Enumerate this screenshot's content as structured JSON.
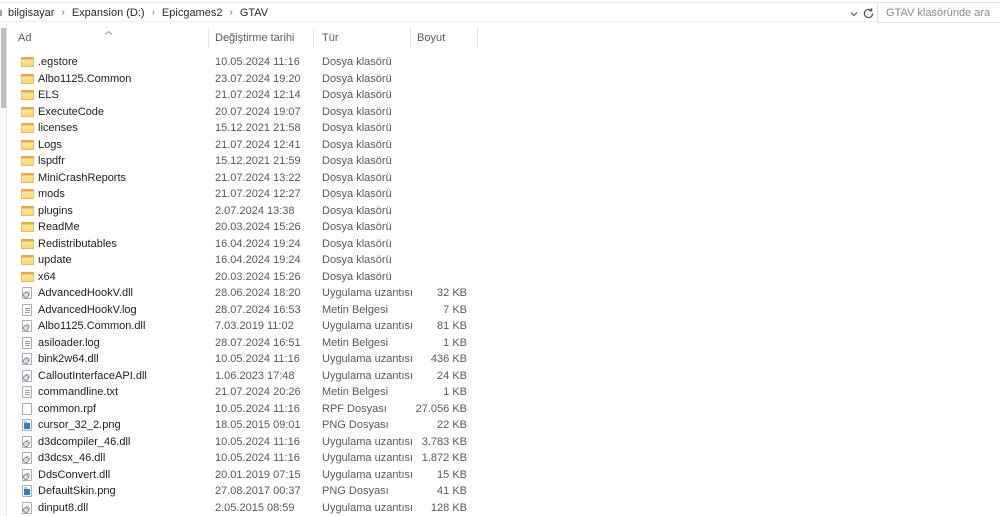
{
  "topbar": {
    "breadcrumb": {
      "crumbs": [
        "bilgisayar",
        "Expansion (D:)",
        "Epicgames2",
        "GTAV"
      ],
      "separator": "›"
    },
    "search": {
      "placeholder": "GTAV klasöründe ara"
    }
  },
  "table": {
    "columns": [
      {
        "label": "Ad"
      },
      {
        "label": "Değiştirme tarihi"
      },
      {
        "label": "Tür"
      },
      {
        "label": "Boyut"
      }
    ],
    "sort": {
      "column": "Ad",
      "direction": "ascending"
    },
    "rows": [
      {
        "name": ".egstore",
        "date": "10.05.2024 11:16",
        "type": "Dosya klasörü",
        "size": "",
        "icon": "folder"
      },
      {
        "name": "Albo1125.Common",
        "date": "23.07.2024 19:20",
        "type": "Dosya klasörü",
        "size": "",
        "icon": "folder"
      },
      {
        "name": "ELS",
        "date": "21.07.2024 12:14",
        "type": "Dosya klasörü",
        "size": "",
        "icon": "folder"
      },
      {
        "name": "ExecuteCode",
        "date": "20.07.2024 19:07",
        "type": "Dosya klasörü",
        "size": "",
        "icon": "folder"
      },
      {
        "name": "licenses",
        "date": "15.12.2021 21:58",
        "type": "Dosya klasörü",
        "size": "",
        "icon": "folder"
      },
      {
        "name": "Logs",
        "date": "21.07.2024 12:41",
        "type": "Dosya klasörü",
        "size": "",
        "icon": "folder"
      },
      {
        "name": "lspdfr",
        "date": "15.12.2021 21:59",
        "type": "Dosya klasörü",
        "size": "",
        "icon": "folder"
      },
      {
        "name": "MiniCrashReports",
        "date": "21.07.2024 13:22",
        "type": "Dosya klasörü",
        "size": "",
        "icon": "folder"
      },
      {
        "name": "mods",
        "date": "21.07.2024 12:27",
        "type": "Dosya klasörü",
        "size": "",
        "icon": "folder"
      },
      {
        "name": "plugins",
        "date": "2.07.2024 13:38",
        "type": "Dosya klasörü",
        "size": "",
        "icon": "folder"
      },
      {
        "name": "ReadMe",
        "date": "20.03.2024 15:26",
        "type": "Dosya klasörü",
        "size": "",
        "icon": "folder"
      },
      {
        "name": "Redistributables",
        "date": "16.04.2024 19:24",
        "type": "Dosya klasörü",
        "size": "",
        "icon": "folder"
      },
      {
        "name": "update",
        "date": "16.04.2024 19:24",
        "type": "Dosya klasörü",
        "size": "",
        "icon": "folder"
      },
      {
        "name": "x64",
        "date": "20.03.2024 15:26",
        "type": "Dosya klasörü",
        "size": "",
        "icon": "folder"
      },
      {
        "name": "AdvancedHookV.dll",
        "date": "28.06.2024 18:20",
        "type": "Uygulama uzantısı",
        "size": "32 KB",
        "icon": "dll"
      },
      {
        "name": "AdvancedHookV.log",
        "date": "28.07.2024 16:53",
        "type": "Metin Belgesi",
        "size": "7 KB",
        "icon": "text"
      },
      {
        "name": "Albo1125.Common.dll",
        "date": "7.03.2019 11:02",
        "type": "Uygulama uzantısı",
        "size": "81 KB",
        "icon": "dll"
      },
      {
        "name": "asiloader.log",
        "date": "28.07.2024 16:51",
        "type": "Metin Belgesi",
        "size": "1 KB",
        "icon": "text"
      },
      {
        "name": "bink2w64.dll",
        "date": "10.05.2024 11:16",
        "type": "Uygulama uzantısı",
        "size": "436 KB",
        "icon": "dll"
      },
      {
        "name": "CalloutInterfaceAPI.dll",
        "date": "1.06.2023 17:48",
        "type": "Uygulama uzantısı",
        "size": "24 KB",
        "icon": "dll"
      },
      {
        "name": "commandline.txt",
        "date": "21.07.2024 20:26",
        "type": "Metin Belgesi",
        "size": "1 KB",
        "icon": "text"
      },
      {
        "name": "common.rpf",
        "date": "10.05.2024 11:16",
        "type": "RPF Dosyası",
        "size": "27.056 KB",
        "icon": "blank"
      },
      {
        "name": "cursor_32_2.png",
        "date": "18.05.2015 09:01",
        "type": "PNG Dosyası",
        "size": "22 KB",
        "icon": "png"
      },
      {
        "name": "d3dcompiler_46.dll",
        "date": "10.05.2024 11:16",
        "type": "Uygulama uzantısı",
        "size": "3.783 KB",
        "icon": "dll"
      },
      {
        "name": "d3dcsx_46.dll",
        "date": "10.05.2024 11:16",
        "type": "Uygulama uzantısı",
        "size": "1.872 KB",
        "icon": "dll"
      },
      {
        "name": "DdsConvert.dll",
        "date": "20.01.2019 07:15",
        "type": "Uygulama uzantısı",
        "size": "15 KB",
        "icon": "dll"
      },
      {
        "name": "DefaultSkin.png",
        "date": "27.08.2017 00:37",
        "type": "PNG Dosyası",
        "size": "41 KB",
        "icon": "png"
      },
      {
        "name": "dinput8.dll",
        "date": "2.05.2015 08:59",
        "type": "Uygulama uzantısı",
        "size": "128 KB",
        "icon": "dll"
      }
    ]
  },
  "colors": {
    "folder_yellow": "#fcd465",
    "folder_tab": "#e9a844",
    "png_blue": "#2e7dd1",
    "header_text": "#4e5c73",
    "secondary_text": "#5a5a5a",
    "separator": "#e5e5e5"
  }
}
